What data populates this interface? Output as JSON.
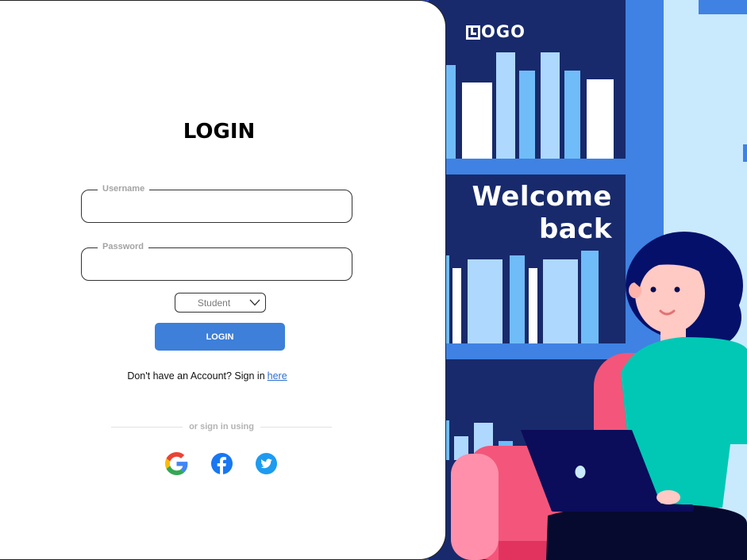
{
  "brand": {
    "logo_text": "OGO"
  },
  "welcome": {
    "line1": "Welcome",
    "line2": "back"
  },
  "form": {
    "title": "LOGIN",
    "username": {
      "label": "Username",
      "value": "",
      "placeholder": ""
    },
    "password": {
      "label": "Password",
      "value": "",
      "placeholder": ""
    },
    "role": {
      "selected": "Student"
    },
    "submit_label": "LOGIN",
    "signup_prompt": "Don't have an Account? Sign in",
    "signup_link": "here",
    "divider_text": "or sign in using"
  },
  "social": [
    "google-icon",
    "facebook-icon",
    "twitter-icon"
  ],
  "colors": {
    "accent": "#3d7fd9",
    "illustration_bg": "#182a6b",
    "shelf_blue": "#3b82e6",
    "shirt": "#00c8b5",
    "sofa": "#f3567a"
  }
}
